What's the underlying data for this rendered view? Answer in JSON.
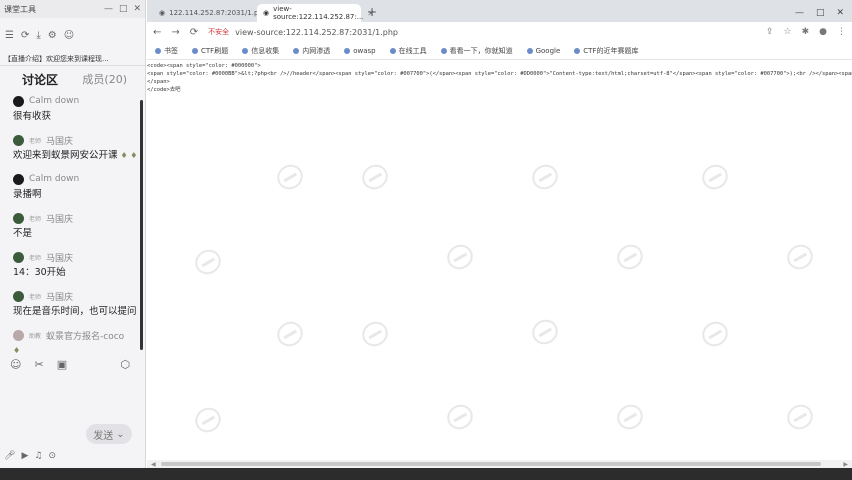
{
  "chat": {
    "window_title": "课堂工具",
    "notice": "【直播介绍】欢迎您来到课程现...",
    "tabs": {
      "discussion": "讨论区",
      "members": "成员(20)"
    },
    "messages": [
      {
        "sender": "Calm down",
        "badge": "",
        "text": "很有收获"
      },
      {
        "sender": "马国庆",
        "badge": "老师",
        "text": "欢迎来到蚁景网安公开课"
      },
      {
        "sender": "Calm down",
        "badge": "",
        "text": "录播啊"
      },
      {
        "sender": "马国庆",
        "badge": "老师",
        "text": "不是"
      },
      {
        "sender": "马国庆",
        "badge": "老师",
        "text": "14：30开始"
      },
      {
        "sender": "马国庆",
        "badge": "老师",
        "text": "现在是音乐时间，也可以提问"
      },
      {
        "sender": "蚁景官方报名-coco",
        "badge": "助教",
        "text": ""
      }
    ],
    "send_label": "发送"
  },
  "browser": {
    "tabs": [
      {
        "title": "122.114.252.87:2031/1.php"
      },
      {
        "title": "view-source:122.114.252.87:..."
      }
    ],
    "omnibox": {
      "security": "不安全",
      "url": "view-source:122.114.252.87:2031/1.php"
    },
    "bookmarks": [
      "书签",
      "CTF刷题",
      "信息收集",
      "内网渗透",
      "owasp",
      "在线工具",
      "看看一下，你就知道",
      "Google",
      "CTF的近年赛题库"
    ],
    "source_lines": [
      "<code><span style=\"color: #000000\">",
      "<span style=\"color: #0000BB\">&lt;?php<br />//header</span><span style=\"color: #007700\">(</span><span style=\"color: #DD0000\">\"Content-type:text/html;charset=utf-8\"</span><span style=\"color: #007700\">);<br /></span><span style=\"color",
      "</span>",
      "</code>去吧"
    ]
  }
}
